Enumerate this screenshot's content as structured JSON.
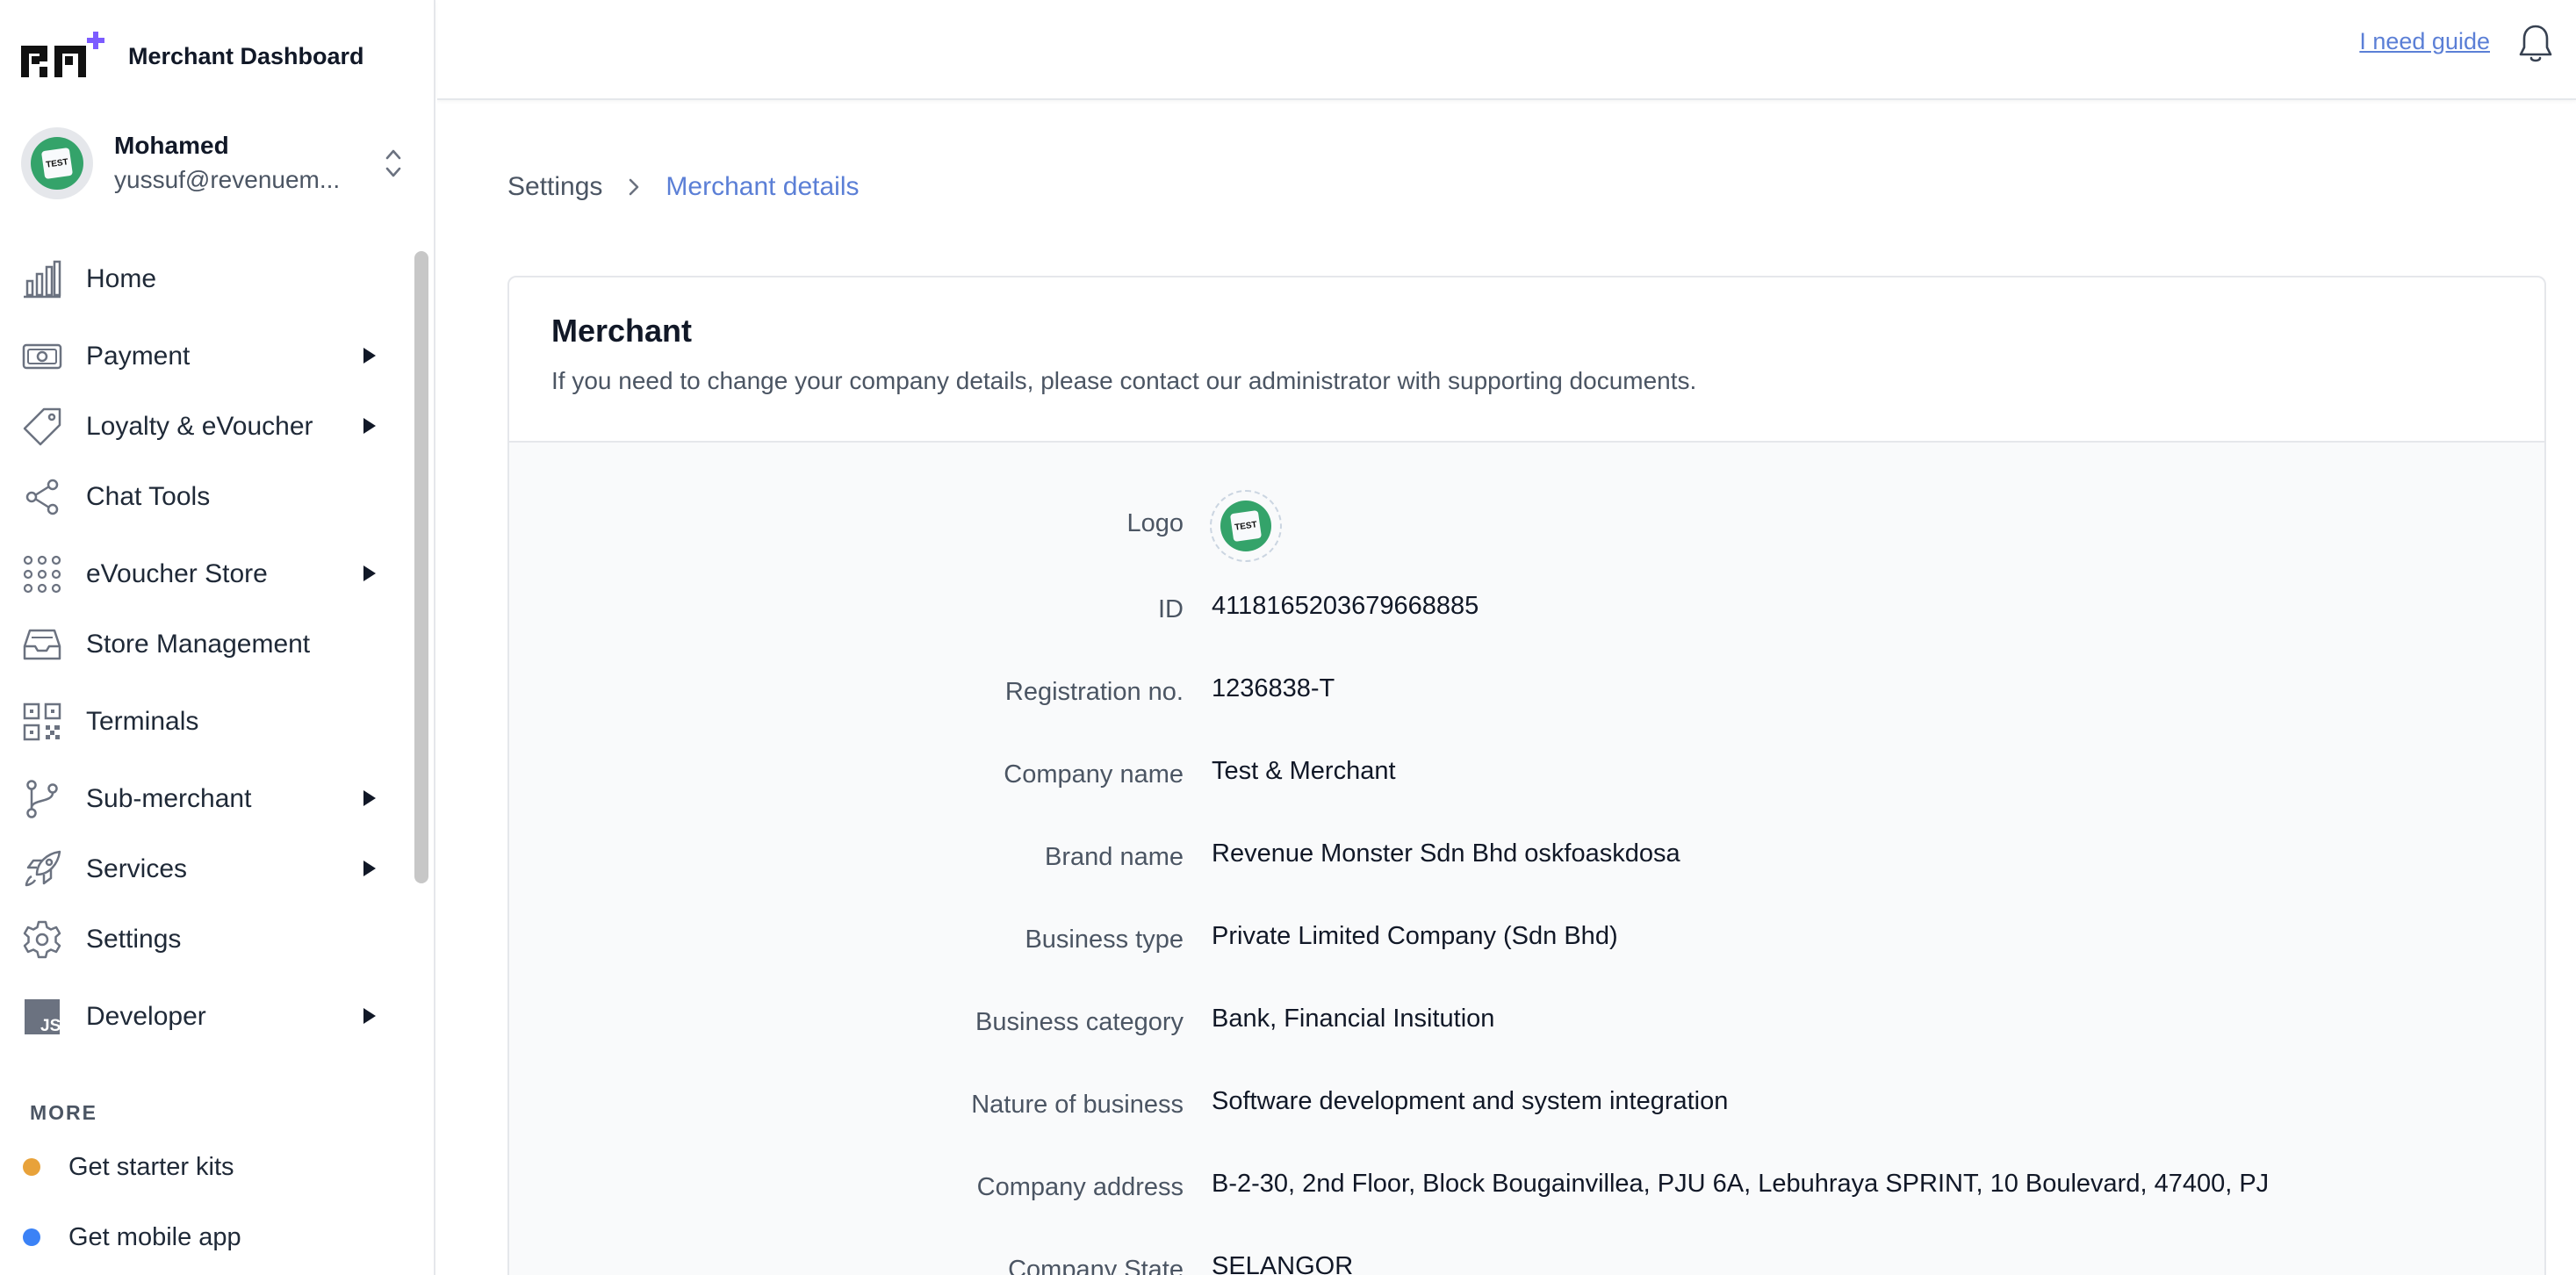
{
  "app": {
    "title": "Merchant Dashboard"
  },
  "account": {
    "name": "Mohamed",
    "email": "yussuf@revenuem..."
  },
  "sidebar": {
    "items": [
      {
        "label": "Home",
        "icon": "bar-chart-icon",
        "expandable": false
      },
      {
        "label": "Payment",
        "icon": "banknote-icon",
        "expandable": true
      },
      {
        "label": "Loyalty & eVoucher",
        "icon": "tag-icon",
        "expandable": true
      },
      {
        "label": "Chat Tools",
        "icon": "share-icon",
        "expandable": false
      },
      {
        "label": "eVoucher Store",
        "icon": "grid-dots-icon",
        "expandable": true
      },
      {
        "label": "Store Management",
        "icon": "inbox-icon",
        "expandable": false
      },
      {
        "label": "Terminals",
        "icon": "qr-code-icon",
        "expandable": false
      },
      {
        "label": "Sub-merchant",
        "icon": "git-branch-icon",
        "expandable": true
      },
      {
        "label": "Services",
        "icon": "rocket-icon",
        "expandable": true
      },
      {
        "label": "Settings",
        "icon": "gear-icon",
        "expandable": false
      },
      {
        "label": "Developer",
        "icon": "js-icon",
        "expandable": true
      }
    ],
    "more_label": "MORE",
    "more_items": [
      {
        "label": "Get starter kits",
        "dot_color": "#e8a23a"
      },
      {
        "label": "Get mobile app",
        "dot_color": "#3b82f6"
      }
    ]
  },
  "header": {
    "guide_link": "I need guide"
  },
  "breadcrumb": {
    "root": "Settings",
    "current": "Merchant details"
  },
  "merchant": {
    "title": "Merchant",
    "subtitle": "If you need to change your company details, please contact our administrator with supporting documents.",
    "logo_label": "Logo",
    "logo_text": "TEST",
    "fields": [
      {
        "label": "ID",
        "value": "4118165203679668885"
      },
      {
        "label": "Registration no.",
        "value": "1236838-T"
      },
      {
        "label": "Company name",
        "value": "Test & Merchant"
      },
      {
        "label": "Brand name",
        "value": "Revenue Monster Sdn Bhd oskfoaskdosa"
      },
      {
        "label": "Business type",
        "value": "Private Limited Company (Sdn Bhd)"
      },
      {
        "label": "Business category",
        "value": "Bank, Financial Insitution"
      },
      {
        "label": "Nature of business",
        "value": "Software development and system integration"
      },
      {
        "label": "Company address",
        "value": "B-2-30, 2nd Floor, Block Bougainvillea, PJU 6A, Lebuhraya SPRINT, 10 Boulevard, 47400, PJ"
      },
      {
        "label": "Company State",
        "value": "SELANGOR"
      }
    ]
  },
  "colors": {
    "accent": "#5b7fd6",
    "avatar_green": "#34a36a"
  }
}
